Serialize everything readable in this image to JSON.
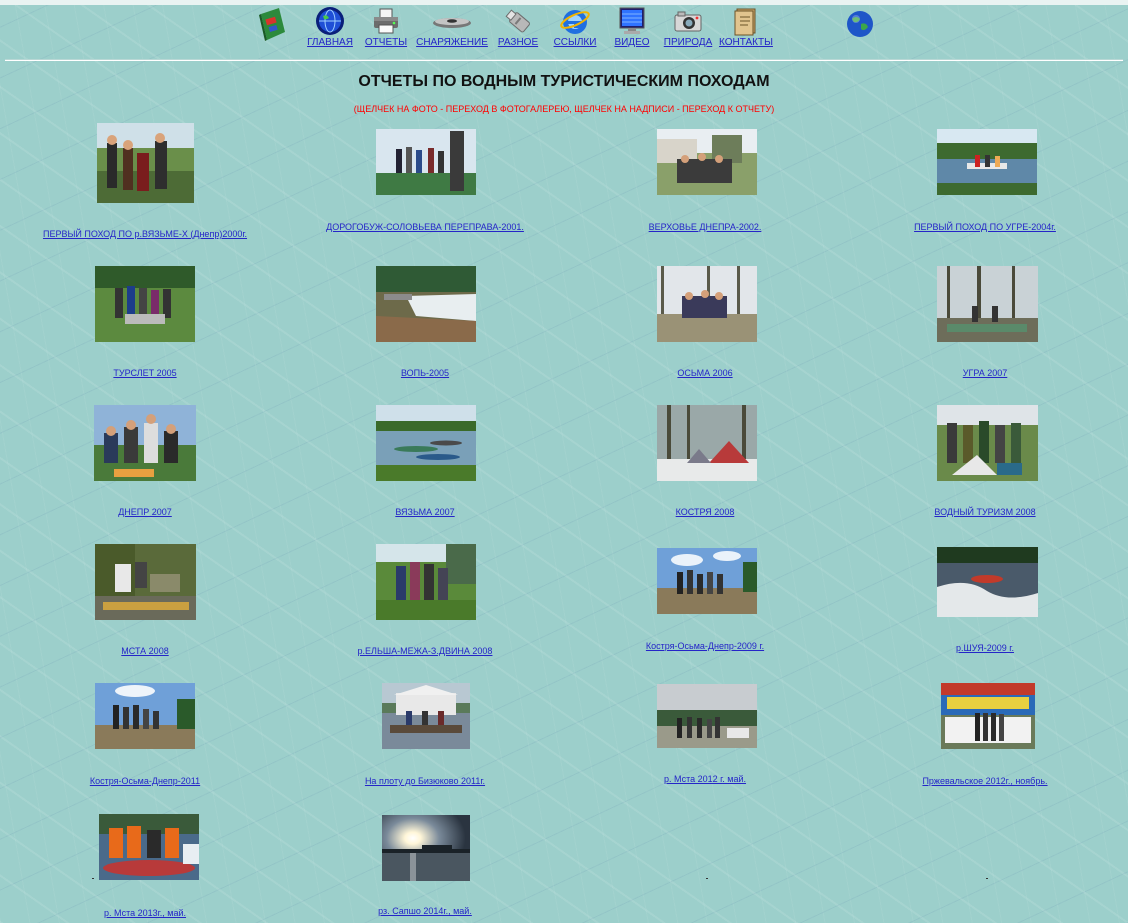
{
  "nav": {
    "items": [
      {
        "label": "ГЛАВНАЯ",
        "icon": "globe-icon"
      },
      {
        "label": "ОТЧЕТЫ",
        "icon": "printer-icon"
      },
      {
        "label": "СНАРЯЖЕНИЕ",
        "icon": "kayak-icon"
      },
      {
        "label": "РАЗНОЕ",
        "icon": "usb-drive-icon"
      },
      {
        "label": "ССЫЛКИ",
        "icon": "internet-explorer-icon"
      },
      {
        "label": "ВИДЕО",
        "icon": "monitor-icon"
      },
      {
        "label": "ПРИРОДА",
        "icon": "camera-icon"
      },
      {
        "label": "КОНТАКТЫ",
        "icon": "address-book-icon"
      }
    ]
  },
  "page": {
    "title": "ОТЧЕТЫ ПО ВОДНЫМ ТУРИСТИЧЕСКИМ ПОХОДАМ",
    "subtitle": "(ЩЕЛЧЕК НА ФОТО - ПЕРЕХОД В ФОТОГАЛЕРЕЮ, ЩЕЛЧЕК НА НАДПИСИ - ПЕРЕХОД К ОТЧЕТУ)"
  },
  "reports": [
    {
      "caption": "ПЕРВЫЙ ПОХОД ПО р.ВЯЗЬМЕ-Х (Днепр)2000г."
    },
    {
      "caption": "ДОРОГОБУЖ-СОЛОВЬЕВА ПЕРЕПРАВА-2001."
    },
    {
      "caption": "ВЕРХОВЬЕ ДНЕПРА-2002."
    },
    {
      "caption": "ПЕРВЫЙ ПОХОД ПО УГРЕ-2004г."
    },
    {
      "caption": "ТУРСЛЕТ 2005"
    },
    {
      "caption": "ВОПЬ-2005"
    },
    {
      "caption": "ОСЬМА 2006"
    },
    {
      "caption": "УГРА 2007"
    },
    {
      "caption": "ДНЕПР 2007"
    },
    {
      "caption": "ВЯЗЬМА 2007"
    },
    {
      "caption": "КОСТРЯ 2008"
    },
    {
      "caption": "ВОДНЫЙ ТУРИЗМ 2008"
    },
    {
      "caption": "МСТА 2008"
    },
    {
      "caption": "р.ЕЛЬША-МЕЖА-З.ДВИНА 2008"
    },
    {
      "caption": "Костря-Осьма-Днепр-2009 г."
    },
    {
      "caption": "р.ШУЯ-2009 г."
    },
    {
      "caption": "Костря-Осьма-Днепр-2011"
    },
    {
      "caption": "На плоту до Бизюково 2011г."
    },
    {
      "caption": "р. Мста 2012 г. май."
    },
    {
      "caption": "Пржевальское 2012г., ноябрь."
    },
    {
      "caption": "р. Мста 2013г., май."
    },
    {
      "caption": "рз. Сапшо 2014г., май."
    }
  ]
}
